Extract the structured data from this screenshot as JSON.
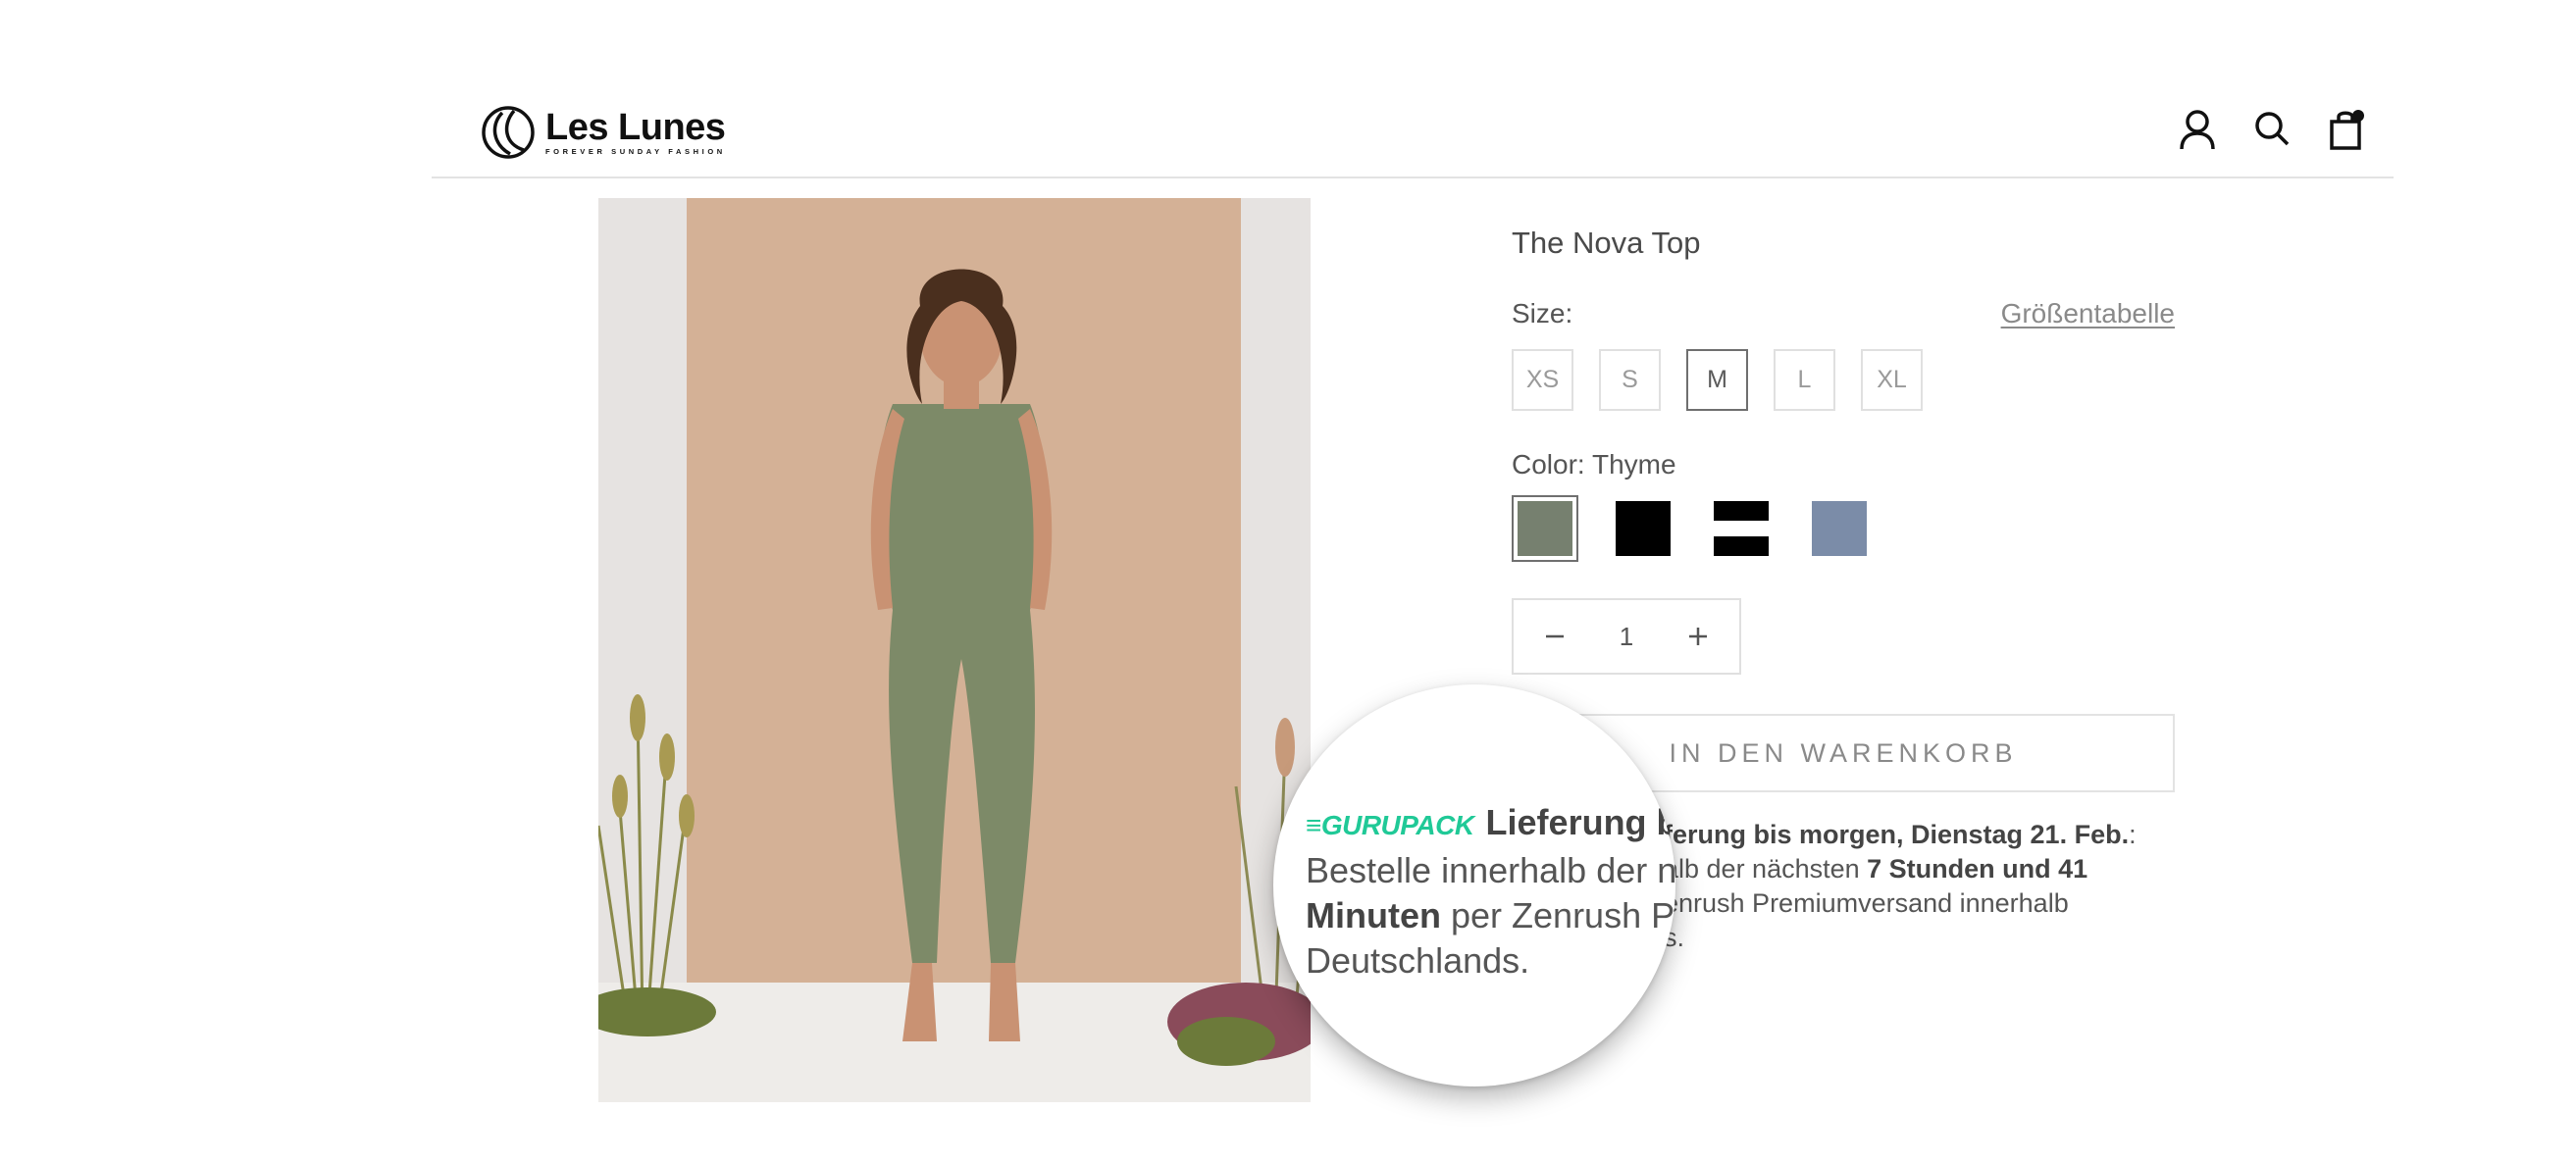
{
  "header": {
    "logo": {
      "name": "Les Lunes",
      "tagline": "FOREVER SUNDAY FASHION"
    },
    "icons": [
      "account-icon",
      "search-icon",
      "cart-icon"
    ]
  },
  "product": {
    "title": "The Nova Top",
    "size_label": "Size:",
    "size_chart_label": "Größentabelle",
    "sizes": [
      "XS",
      "S",
      "M",
      "L",
      "XL"
    ],
    "selected_size": "M",
    "color_label": "Color:",
    "color_value": "Thyme",
    "colors": [
      {
        "name": "Thyme",
        "hex": "#76806f"
      },
      {
        "name": "Black",
        "hex": "#000000"
      },
      {
        "name": "Black/White stripe",
        "hex": "#000000"
      },
      {
        "name": "Blue",
        "hex": "#7b8ca8"
      }
    ],
    "quantity": "1",
    "add_to_cart": "IN DEN WARENKORB"
  },
  "delivery": {
    "brand": "≡GURUPACK",
    "line_1": "Lieferung bis morgen, Dienstag 21. Feb.",
    "line_1_suffix": ":",
    "order_prefix": "Bestelle innerhalb der nächsten",
    "countdown": "7 Stunden und 41 Minuten",
    "order_suffix": "per Zenrush Premiumversand innerhalb Deutschlands.",
    "visible_line_1": "ferung bis morgen, Dienstag 21. Feb.",
    "visible_line_2_prefix": "alb der nächsten",
    "visible_line_2_bold": "7 Stunden und 41",
    "visible_line_3": "enrush Premiumversand innerhalb",
    "visible_line_4": "s."
  },
  "magnifier": {
    "brand": "≡GURUPACK",
    "title": "Lieferung bis",
    "line_2": "Bestelle innerhalb der n",
    "line_3_bold": "Minuten",
    "line_3_rest": "per Zenrush Pre",
    "line_4": "Deutschlands."
  },
  "colors": {
    "accent_green": "#20c997",
    "border": "#e3e3e3",
    "text": "#4a4a4a"
  }
}
